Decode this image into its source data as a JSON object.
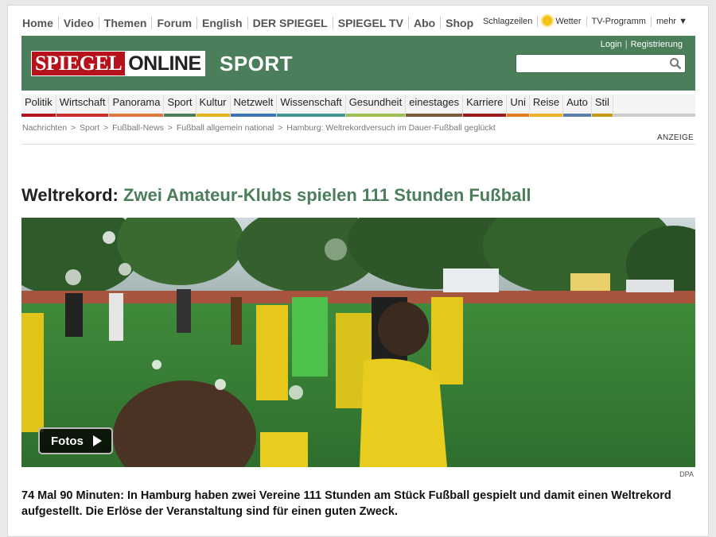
{
  "topnav": [
    "Home",
    "Video",
    "Themen",
    "Forum",
    "English",
    "DER SPIEGEL",
    "SPIEGEL TV",
    "Abo",
    "Shop"
  ],
  "toplinks": {
    "schlagzeilen": "Schlagzeilen",
    "wetter": "Wetter",
    "tv": "TV-Programm",
    "mehr": "mehr ▼"
  },
  "header": {
    "login": "Login",
    "register": "Registrierung",
    "logo_spiegel": "SPIEGEL",
    "logo_online": "ONLINE",
    "section": "SPORT",
    "search_placeholder": ""
  },
  "sections": [
    {
      "label": "Politik",
      "color": "#b5121b"
    },
    {
      "label": "Wirtschaft",
      "color": "#c9302c"
    },
    {
      "label": "Panorama",
      "color": "#e0783e"
    },
    {
      "label": "Sport",
      "color": "#4b7e5a"
    },
    {
      "label": "Kultur",
      "color": "#e7b21e"
    },
    {
      "label": "Netzwelt",
      "color": "#3b74b8"
    },
    {
      "label": "Wissenschaft",
      "color": "#3e9a8f"
    },
    {
      "label": "Gesundheit",
      "color": "#9cbf4f"
    },
    {
      "label": "einestages",
      "color": "#7a5a3a"
    },
    {
      "label": "Karriere",
      "color": "#9b1b1f"
    },
    {
      "label": "Uni",
      "color": "#e27a1e"
    },
    {
      "label": "Reise",
      "color": "#f0b122"
    },
    {
      "label": "Auto",
      "color": "#5a7fa8"
    },
    {
      "label": "Stil",
      "color": "#c79a1a"
    }
  ],
  "breadcrumb": [
    "Nachrichten",
    "Sport",
    "Fußball-News",
    "Fußball allgemein national",
    "Hamburg: Weltrekordversuch im Dauer-Fußball geglückt"
  ],
  "anzeige": "ANZEIGE",
  "headline": {
    "kicker": "Weltrekord:",
    "main": "Zwei Amateur-Klubs spielen 111 Stunden Fußball"
  },
  "photo": {
    "button": "Fotos",
    "credit": "DPA"
  },
  "teaser": "74 Mal 90 Minuten: In Hamburg haben zwei Vereine 111 Stunden am Stück Fußball gespielt und damit einen Weltrekord aufgestellt. Die Erlöse der Veranstaltung sind für einen guten Zweck."
}
